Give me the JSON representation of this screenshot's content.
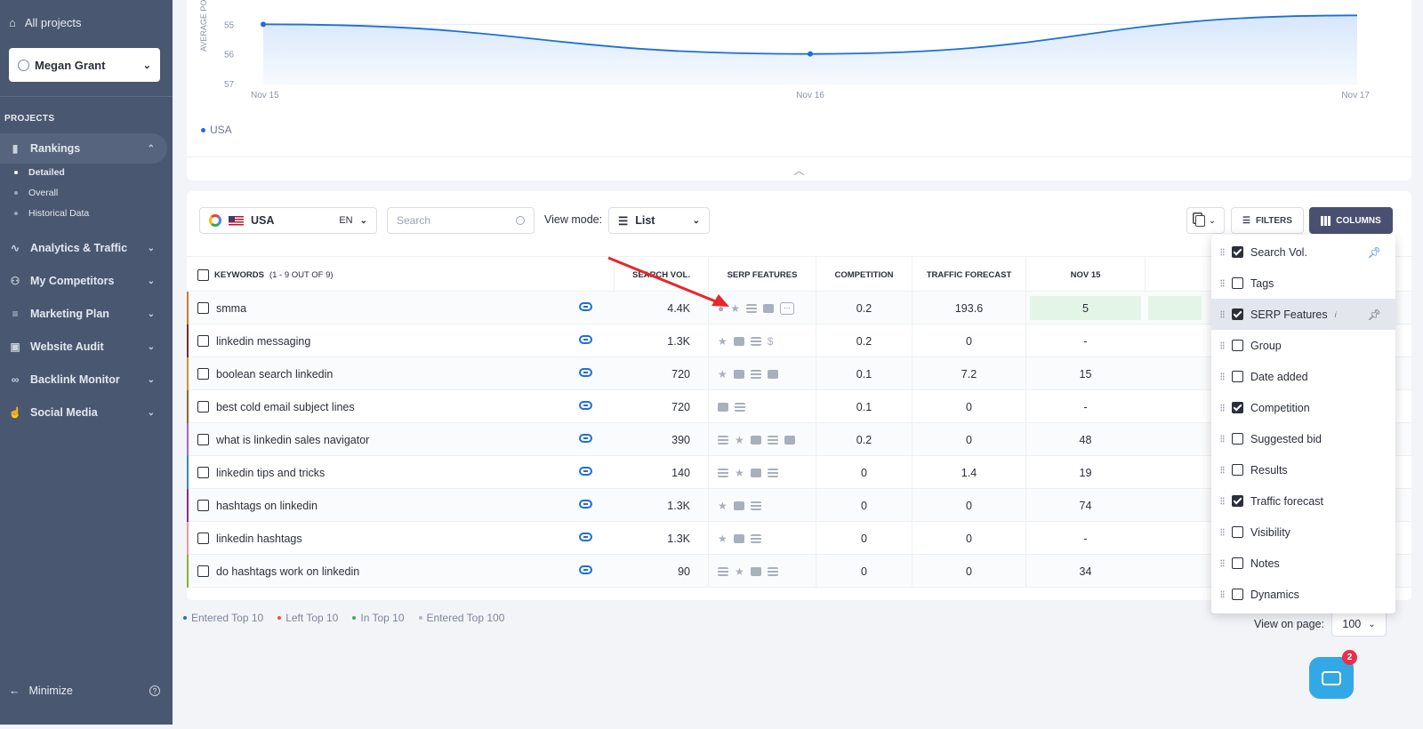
{
  "sidebar": {
    "all_projects": "All projects",
    "user": "Megan Grant",
    "projects_label": "PROJECTS",
    "items": [
      {
        "label": "Rankings",
        "icon": "bar-chart-icon",
        "expanded": true
      },
      {
        "label": "Analytics & Traffic",
        "icon": "pulse-icon"
      },
      {
        "label": "My Competitors",
        "icon": "users-icon"
      },
      {
        "label": "Marketing Plan",
        "icon": "checklist-icon"
      },
      {
        "label": "Website Audit",
        "icon": "audit-icon"
      },
      {
        "label": "Backlink Monitor",
        "icon": "link-icon"
      },
      {
        "label": "Social Media",
        "icon": "thumbs-up-icon"
      }
    ],
    "sub_items": [
      "Detailed",
      "Overall",
      "Historical Data"
    ],
    "minimize": "Minimize"
  },
  "chart_data": {
    "type": "line",
    "x": [
      "Nov 15",
      "Nov 16",
      "Nov 17"
    ],
    "series": [
      {
        "name": "USA",
        "values": [
          55,
          56,
          54.7
        ]
      }
    ],
    "ylabel": "AVERAGE PO",
    "yticks": [
      "55",
      "56",
      "57"
    ],
    "ylim": [
      54.6,
      57
    ],
    "y_inverted": true,
    "color": "#1d6fd6"
  },
  "chart_legend": "USA",
  "toolbar": {
    "country": "USA",
    "lang": "EN",
    "search_placeholder": "Search",
    "view_mode_label": "View mode:",
    "view_mode_value": "List",
    "filters": "FILTERS",
    "columns": "COLUMNS"
  },
  "table": {
    "headers": {
      "keywords": "KEYWORDS",
      "keywords_count": "(1 - 9 OUT OF 9)",
      "search_vol": "SEARCH VOL.",
      "serp": "SERP FEATURES",
      "competition": "COMPETITION",
      "traffic": "TRAFFIC FORECAST",
      "nov15": "NOV 15"
    },
    "rows": [
      {
        "kw": "smma",
        "vol": "4.4K",
        "comp": "0.2",
        "traffic": "193.6",
        "nov15": "5",
        "color": "#c97a3a",
        "serp": "pin star table video more",
        "hl": true
      },
      {
        "kw": "linkedin messaging",
        "vol": "1.3K",
        "comp": "0.2",
        "traffic": "0",
        "nov15": "-",
        "color": "#7a2a2a",
        "serp": "star video list dollar"
      },
      {
        "kw": "boolean search linkedin",
        "vol": "720",
        "comp": "0.1",
        "traffic": "7.2",
        "nov15": "15",
        "color": "#c9923a",
        "serp": "star video list image"
      },
      {
        "kw": "best cold email subject lines",
        "vol": "720",
        "comp": "0.1",
        "traffic": "0",
        "nov15": "-",
        "color": "#8a6a2a",
        "serp": "video list"
      },
      {
        "kw": "what is linkedin sales navigator",
        "vol": "390",
        "comp": "0.2",
        "traffic": "0",
        "nov15": "48",
        "color": "#a06ac9",
        "serp": "list star video list image"
      },
      {
        "kw": "linkedin tips and tricks",
        "vol": "140",
        "comp": "0",
        "traffic": "1.4",
        "nov15": "19",
        "color": "#3a8ab0",
        "serp": "list star video list"
      },
      {
        "kw": "hashtags on linkedin",
        "vol": "1.3K",
        "comp": "0",
        "traffic": "0",
        "nov15": "74",
        "color": "#8a2a8a",
        "serp": "star video list"
      },
      {
        "kw": "linkedin hashtags",
        "vol": "1.3K",
        "comp": "0",
        "traffic": "0",
        "nov15": "-",
        "color": "#e89aa0",
        "serp": "star video list"
      },
      {
        "kw": "do hashtags work on linkedin",
        "vol": "90",
        "comp": "0",
        "traffic": "0",
        "nov15": "34",
        "color": "#8ab03a",
        "serp": "list star video list"
      }
    ]
  },
  "legend": [
    "Entered Top 10",
    "Left Top 10",
    "In Top 10",
    "Entered Top 100"
  ],
  "legend_colors": [
    "#1d6fd6",
    "#e8504b",
    "#3ab05a",
    "#b0b6c2"
  ],
  "view_on_page_label": "View on page:",
  "view_on_page_value": "100",
  "columns_menu": [
    {
      "label": "Search Vol.",
      "checked": true,
      "pin": "blue"
    },
    {
      "label": "Tags",
      "checked": false
    },
    {
      "label": "SERP Features",
      "checked": true,
      "pin": "grey",
      "hl": true,
      "info": true
    },
    {
      "label": "Group",
      "checked": false
    },
    {
      "label": "Date added",
      "checked": false
    },
    {
      "label": "Competition",
      "checked": true
    },
    {
      "label": "Suggested bid",
      "checked": false
    },
    {
      "label": "Results",
      "checked": false
    },
    {
      "label": "Traffic forecast",
      "checked": true
    },
    {
      "label": "Visibility",
      "checked": false
    },
    {
      "label": "Notes",
      "checked": false
    },
    {
      "label": "Dynamics",
      "checked": false
    }
  ],
  "chat_badge": "2"
}
